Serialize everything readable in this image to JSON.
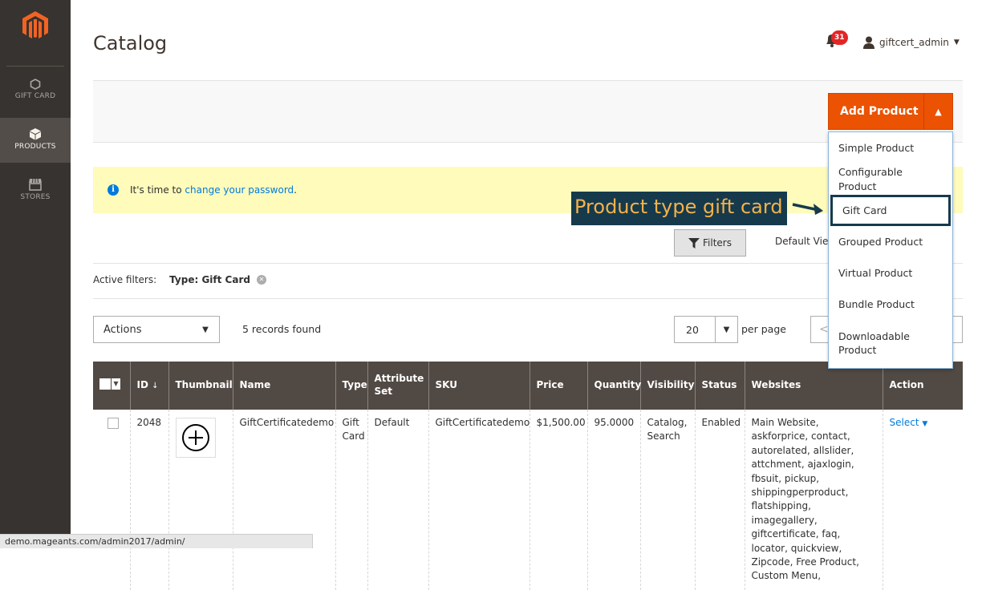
{
  "sidebar": {
    "items": [
      {
        "label": "GIFT CARD",
        "icon": "hexagon-icon"
      },
      {
        "label": "PRODUCTS",
        "icon": "box-icon"
      },
      {
        "label": "STORES",
        "icon": "store-icon"
      }
    ]
  },
  "header": {
    "title": "Catalog",
    "notifications": "31",
    "user": "giftcert_admin"
  },
  "add_product": {
    "label": "Add Product",
    "menu": [
      "Simple Product",
      "Configurable Product",
      "Gift Card",
      "Grouped Product",
      "Virtual Product",
      "Bundle Product",
      "Downloadable Product"
    ]
  },
  "notice": {
    "prefix": "It's time to ",
    "link": "change your password",
    "suffix": "."
  },
  "callout": "Product type gift card",
  "toolbar": {
    "filters": "Filters",
    "default_view": "Default View",
    "active_filters_label": "Active filters:",
    "active_filter": "Type: Gift Card",
    "actions": "Actions",
    "records": "5 records found",
    "per_page_value": "20",
    "per_page_label": "per page",
    "pager_prev": "<"
  },
  "grid": {
    "columns": [
      "ID",
      "Thumbnail",
      "Name",
      "Type",
      "Attribute Set",
      "SKU",
      "Price",
      "Quantity",
      "Visibility",
      "Status",
      "Websites",
      "Action"
    ],
    "sort_indicator": "↓",
    "row": {
      "id": "2048",
      "name": "GiftCertificatedemo",
      "type": "Gift Card",
      "attribute_set": "Default",
      "sku": "GiftCertificatedemo",
      "price": "$1,500.00",
      "quantity": "95.0000",
      "visibility": "Catalog, Search",
      "status": "Enabled",
      "websites": "Main Website, askforprice, contact, autorelated, allslider, attchment, ajaxlogin, fbsuit, pickup, shippingperproduct, flatshipping, imagegallery, giftcertificate, faq, locator, quickview, Zipcode, Free Product, Custom Menu,",
      "action": "Select"
    }
  },
  "status_bar": "demo.mageants.com/admin2017/admin/",
  "colors": {
    "accent": "#eb5202",
    "sidebar": "#373330",
    "grid_header": "#514943",
    "link": "#007bdb",
    "callout_bg": "#163a4c",
    "callout_text": "#f5b14a"
  }
}
